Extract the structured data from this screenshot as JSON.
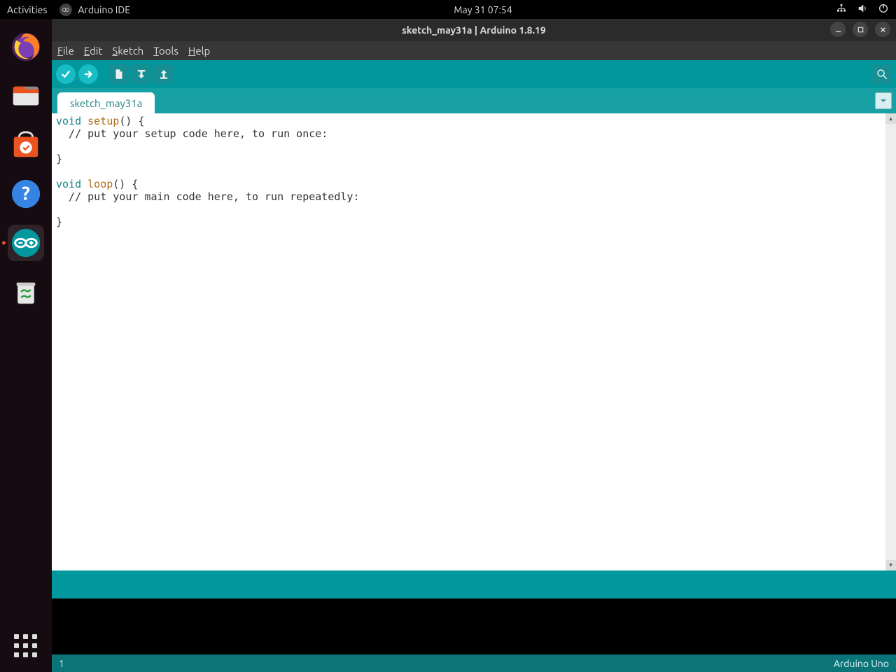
{
  "topbar": {
    "activities": "Activities",
    "app_name": "Arduino IDE",
    "clock": "May 31  07:54"
  },
  "window": {
    "title": "sketch_may31a | Arduino 1.8.19"
  },
  "menubar": {
    "file": "File",
    "edit": "Edit",
    "sketch": "Sketch",
    "tools": "Tools",
    "help": "Help"
  },
  "tabs": {
    "active": "sketch_may31a"
  },
  "code": {
    "lines": [
      {
        "t": "kw",
        "v": "void"
      },
      {
        "t": "sp"
      },
      {
        "t": "fn",
        "v": "setup"
      },
      {
        "t": "p",
        "v": "() {"
      },
      {
        "t": "nl"
      },
      {
        "t": "p",
        "v": "  // put your setup code here, to run once:"
      },
      {
        "t": "nl"
      },
      {
        "t": "nl"
      },
      {
        "t": "p",
        "v": "}"
      },
      {
        "t": "nl"
      },
      {
        "t": "nl"
      },
      {
        "t": "kw",
        "v": "void"
      },
      {
        "t": "sp"
      },
      {
        "t": "fn",
        "v": "loop"
      },
      {
        "t": "p",
        "v": "() {"
      },
      {
        "t": "nl"
      },
      {
        "t": "p",
        "v": "  // put your main code here, to run repeatedly:"
      },
      {
        "t": "nl"
      },
      {
        "t": "nl"
      },
      {
        "t": "p",
        "v": "}"
      }
    ]
  },
  "footer": {
    "line_number": "1",
    "board": "Arduino Uno"
  }
}
